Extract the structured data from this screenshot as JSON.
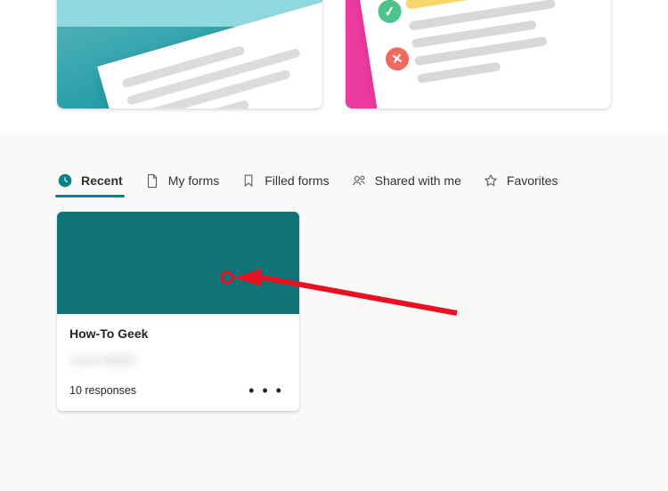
{
  "tabs": [
    {
      "label": "Recent"
    },
    {
      "label": "My forms"
    },
    {
      "label": "Filled forms"
    },
    {
      "label": "Shared with me"
    },
    {
      "label": "Favorites"
    }
  ],
  "active_tab_index": 0,
  "cards": [
    {
      "title": "How-To Geek",
      "subtitle_redacted": "some.hidden",
      "responses_label": "10 responses"
    }
  ],
  "icons": {
    "more": "• • •"
  }
}
